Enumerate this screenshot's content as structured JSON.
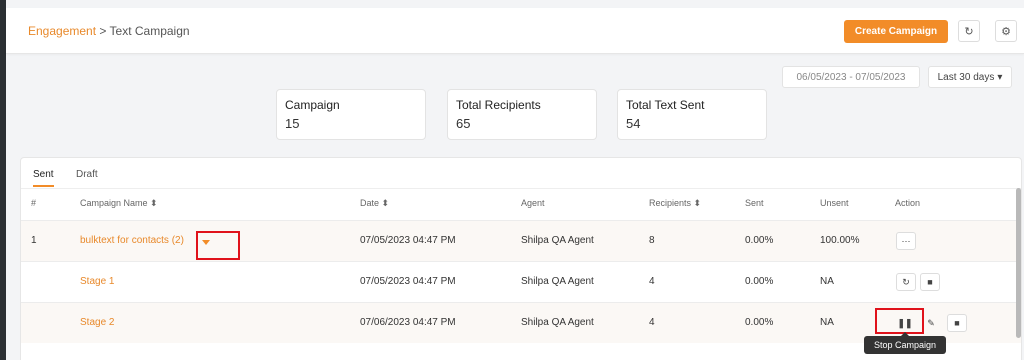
{
  "breadcrumb": {
    "parent": "Engagement",
    "separator": " > ",
    "current": "Text Campaign"
  },
  "header": {
    "create_button": "Create Campaign",
    "refresh_icon": "refresh-icon",
    "settings_icon": "gear-icon"
  },
  "filters": {
    "date_range": "06/05/2023 - 07/05/2023",
    "range_select": "Last 30 days",
    "range_caret": "▾"
  },
  "stats": [
    {
      "label": "Campaign",
      "value": "15"
    },
    {
      "label": "Total Recipients",
      "value": "65"
    },
    {
      "label": "Total Text Sent",
      "value": "54"
    }
  ],
  "tabs": [
    "Sent",
    "Draft"
  ],
  "table": {
    "headers": [
      "#",
      "Campaign Name ⬍",
      "Date ⬍",
      "Agent",
      "Recipients ⬍",
      "Sent",
      "Unsent",
      "Action"
    ],
    "rows": [
      {
        "num": "1",
        "name": "bulktext for contacts (2)",
        "date": "07/05/2023 04:47 PM",
        "agent": "Shilpa QA Agent",
        "recipients": "8",
        "sent": "0.00%",
        "unsent": "100.00%",
        "actions": [
          "more-icon"
        ]
      },
      {
        "num": "",
        "name": "Stage 1",
        "date": "07/05/2023 04:47 PM",
        "agent": "Shilpa QA Agent",
        "recipients": "4",
        "sent": "0.00%",
        "unsent": "NA",
        "actions": [
          "refresh-icon",
          "trash-icon"
        ]
      },
      {
        "num": "",
        "name": "Stage 2",
        "date": "07/06/2023 04:47 PM",
        "agent": "Shilpa QA Agent",
        "recipients": "4",
        "sent": "0.00%",
        "unsent": "NA",
        "actions": [
          "pause-icon",
          "edit-icon",
          "trash-icon"
        ]
      }
    ]
  },
  "tooltip": "Stop Campaign",
  "colors": {
    "accent": "#f28c28",
    "highlight_box": "#e0121b"
  }
}
